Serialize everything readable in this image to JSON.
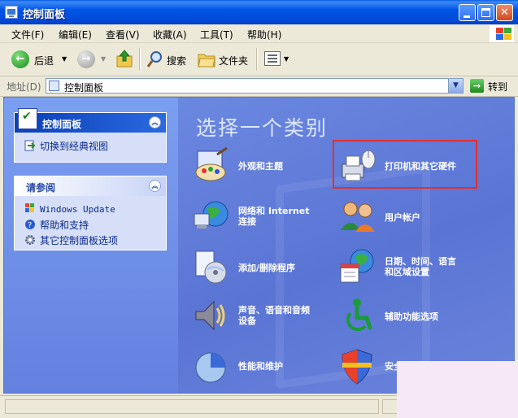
{
  "window": {
    "title": "控制面板"
  },
  "menu": [
    "文件(F)",
    "编辑(E)",
    "查看(V)",
    "收藏(A)",
    "工具(T)",
    "帮助(H)"
  ],
  "toolbar": {
    "back": "后退",
    "search": "搜索",
    "folders": "文件夹"
  },
  "address": {
    "label": "地址(D)",
    "value": "控制面板",
    "go": "转到"
  },
  "left_pane": {
    "panel1": {
      "title": "控制面板",
      "links": [
        "切换到经典视图"
      ]
    },
    "panel2": {
      "title": "请参阅",
      "links": [
        "Windows Update",
        "帮助和支持",
        "其它控制面板选项"
      ]
    }
  },
  "main": {
    "heading": "选择一个类别",
    "categories": [
      {
        "label": "外观和主题",
        "icon": "appearance-themes-icon"
      },
      {
        "label": "打印机和其它硬件",
        "icon": "printer-hardware-icon",
        "highlighted": true
      },
      {
        "label_line1": "网络和 Internet",
        "label_line2": "连接",
        "icon": "network-internet-icon"
      },
      {
        "label": "用户帐户",
        "icon": "user-accounts-icon"
      },
      {
        "label": "添加/删除程序",
        "icon": "add-remove-programs-icon"
      },
      {
        "label_line1": "日期、时间、语言",
        "label_line2": "和区域设置",
        "icon": "date-time-language-icon"
      },
      {
        "label_line1": "声音、语音和音频",
        "label_line2": "设备",
        "icon": "sounds-audio-icon"
      },
      {
        "label": "辅助功能选项",
        "icon": "accessibility-icon"
      },
      {
        "label": "性能和维护",
        "icon": "performance-maintenance-icon"
      },
      {
        "label": "安全中心",
        "icon": "security-center-icon"
      }
    ]
  },
  "colors": {
    "title_bar": "#0055e5",
    "left_pane": "#6381e0",
    "right_pane": "#5a74d4",
    "highlight_border": "#e03030"
  }
}
